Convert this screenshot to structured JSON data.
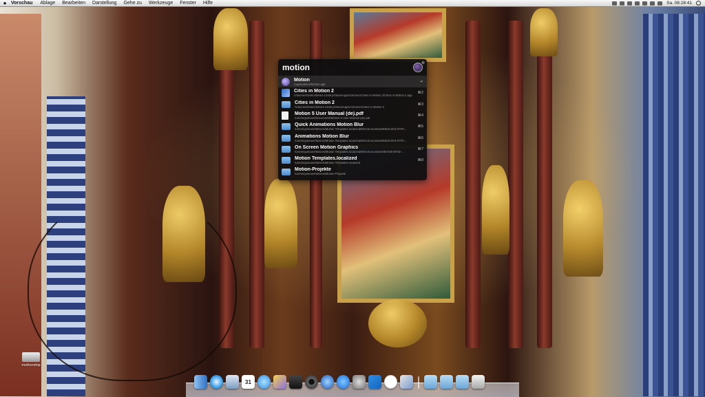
{
  "menubar": {
    "apple": "",
    "app": "Vorschau",
    "items": [
      "Ablage",
      "Bearbeiten",
      "Darstellung",
      "Gehe zu",
      "Werkzeuge",
      "Fenster",
      "Hilfe"
    ],
    "clock": "Sa. 08:28:41"
  },
  "spotlight": {
    "query": "motion",
    "close": "⊗",
    "results": [
      {
        "name": "Motion",
        "path": "/Applications/Motion.app",
        "key": "↵",
        "icon": "app-icon"
      },
      {
        "name": "Cities in Motion 2",
        "path": "/Volumes/Daten/Steam Library/SteamApps/common/Cities in Motion 2/Cities in Motion 2.app",
        "key": "⌘2",
        "icon": "app-icon"
      },
      {
        "name": "Cities in Motion 2",
        "path": "/Volumes/Daten/Steam Library/SteamApps/common/Cities in Motion 2",
        "key": "⌘3",
        "icon": "folder-icon"
      },
      {
        "name": "Motion 5 User Manual (de).pdf",
        "path": "/Users/quimaier/Documents/Motion 5 User Manual (de).pdf",
        "key": "⌘4",
        "icon": "pdf-icon"
      },
      {
        "name": "Quick Animations Motion Blur",
        "path": "/Users/quimaier/Movies/Motion Templates.localized/Effects.localized/8452A2C6-07F0-...",
        "key": "⌘5",
        "icon": "folder-icon"
      },
      {
        "name": "Animations Motion Blur",
        "path": "/Users/quimaier/Movies/Motion Templates.localized/Effects.localized/8452A2C6-07F0-...",
        "key": "⌘6",
        "icon": "folder-icon"
      },
      {
        "name": "On Screen Motion Graphics",
        "path": "/Users/quimaier/Movies/Motion Templates.localized/Effects.localized/4B7265-6F4D-...",
        "key": "⌘7",
        "icon": "folder-icon"
      },
      {
        "name": "Motion Templates.localized",
        "path": "/Users/quimaier/Movies/Motion Templates.localized",
        "key": "⌘8",
        "icon": "folder-icon"
      },
      {
        "name": "Motion-Projekte",
        "path": "/Users/quimaier/Movies/Motion-Projekte",
        "key": "",
        "icon": "folder-icon"
      }
    ]
  },
  "desktop": {
    "drive_label": "mothership"
  },
  "dock": {
    "icons": [
      "finder-icon",
      "safari-icon",
      "preview-icon",
      "calendar-icon",
      "messages-icon",
      "motion-icon",
      "final-cut-icon",
      "camera-icon",
      "itunes-icon",
      "app-store-icon",
      "system-preferences-icon",
      "windows-icon",
      "clock-icon",
      "photo-icon",
      "folder-icon",
      "folder-icon",
      "folder-icon",
      "trash-icon"
    ],
    "calendar_day": "31",
    "colors": {
      "finder": "#4a90d9",
      "safari": "#3aa0e8",
      "motion": "#8a6fe0",
      "trash": "#cfcfcf"
    }
  }
}
